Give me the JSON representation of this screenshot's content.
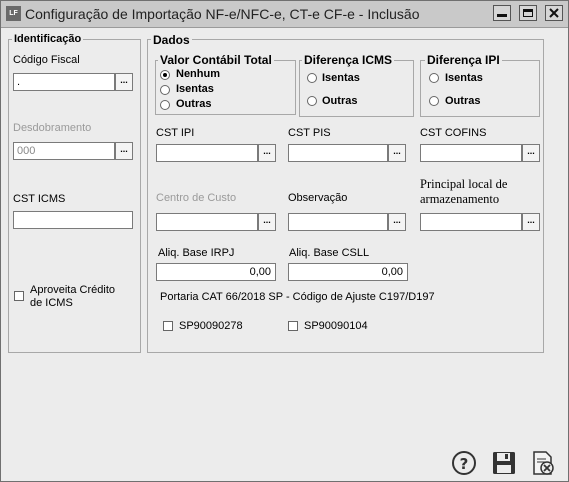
{
  "window": {
    "logo": "LF",
    "title": "Configuração de Importação NF-e/NFC-e, CT-e CF-e - Inclusão"
  },
  "identificacao": {
    "title": "Identificação",
    "codigo_fiscal_label": "Código Fiscal",
    "codigo_fiscal_value": ".",
    "desdobramento_label": "Desdobramento",
    "desdobramento_value": "000",
    "cst_icms_label": "CST ICMS",
    "cst_icms_value": "",
    "aproveita_label_1": "Aproveita Crédito",
    "aproveita_label_2": "de ICMS",
    "aproveita_checked": false
  },
  "dados": {
    "title": "Dados",
    "valor_contabil": {
      "title": "Valor Contábil Total",
      "options": [
        "Nenhum",
        "Isentas",
        "Outras"
      ],
      "selected": "Nenhum"
    },
    "diferenca_icms": {
      "title": "Diferença ICMS",
      "options": [
        "Isentas",
        "Outras"
      ]
    },
    "diferenca_ipi": {
      "title": "Diferença IPI",
      "options": [
        "Isentas",
        "Outras"
      ]
    },
    "cst_ipi_label": "CST IPI",
    "cst_pis_label": "CST PIS",
    "cst_cofins_label": "CST COFINS",
    "centro_custo_label": "Centro de Custo",
    "observacao_label": "Observação",
    "principal_local_label_1": "Principal local de",
    "principal_local_label_2": "armazenamento",
    "aliq_irpj_label": "Aliq. Base IRPJ",
    "aliq_irpj_value": "0,00",
    "aliq_csll_label": "Aliq. Base CSLL",
    "aliq_csll_value": "0,00",
    "portaria_text": "Portaria CAT 66/2018 SP - Código de Ajuste C197/D197",
    "ajuste_1": "SP90090278",
    "ajuste_2": "SP90090104"
  },
  "lookup_glyph": "...",
  "icons": [
    "help-icon",
    "save-icon",
    "cancel-icon"
  ]
}
